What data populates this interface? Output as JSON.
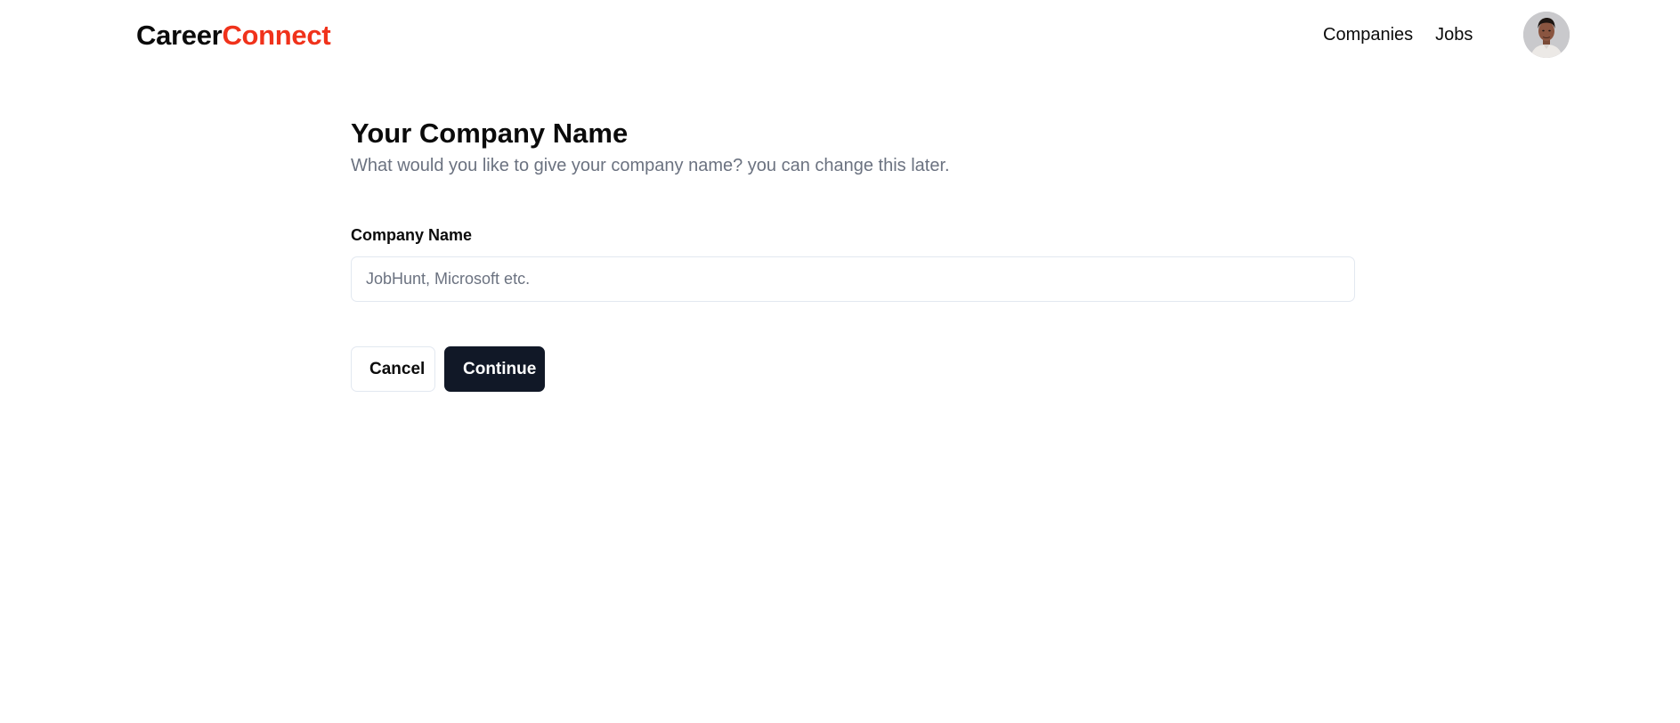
{
  "header": {
    "logo_part1": "Career",
    "logo_part2": "Connect",
    "nav": [
      {
        "label": "Companies"
      },
      {
        "label": "Jobs"
      }
    ],
    "avatar_icon": "user-avatar"
  },
  "main": {
    "title": "Your Company Name",
    "subtitle": "What would you like to give your company name? you can change this later.",
    "field_label": "Company Name",
    "input_value": "",
    "input_placeholder": "JobHunt, Microsoft etc.",
    "cancel_label": "Cancel",
    "continue_label": "Continue"
  },
  "colors": {
    "brand_accent": "#f0321b",
    "primary_button": "#111827",
    "muted_text": "#6b7280",
    "border": "#e2e8f0"
  }
}
